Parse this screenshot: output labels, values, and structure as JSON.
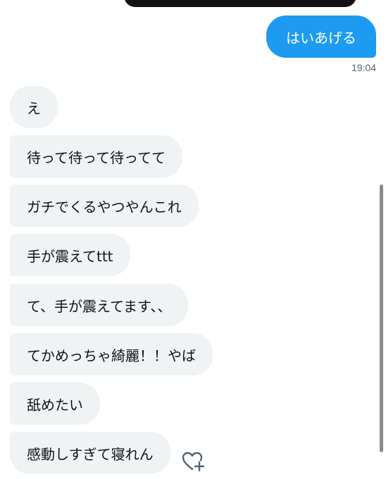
{
  "conversation": {
    "sent_messages": [
      {
        "text": "はいあげる",
        "time": "19:04"
      }
    ],
    "received_messages": [
      "え",
      "待って待って待ってて",
      "ガチでくるやつやんこれ",
      "手が震えてttt",
      "て、手が震えてます、、",
      "てかめっちゃ綺麗！！やば",
      "舐めたい",
      "感動しすぎて寝れん"
    ]
  },
  "reaction": {
    "icon": "add-reaction-heart-icon"
  },
  "colors": {
    "sent_bubble": "#1d9bf0",
    "received_bubble": "#eff3f4",
    "timestamp": "#536471"
  }
}
